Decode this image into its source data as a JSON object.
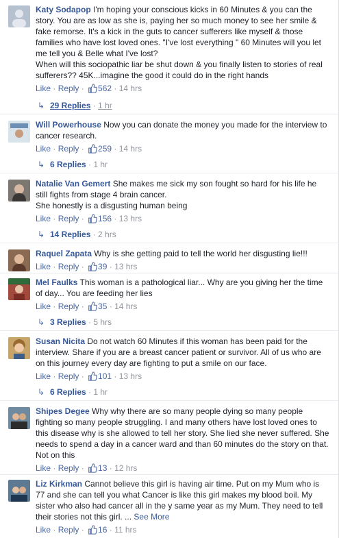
{
  "ui": {
    "like": "Like",
    "reply": "Reply",
    "sep": " · "
  },
  "comments": [
    {
      "author": "Katy Sodapop",
      "text": "I'm hoping your conscious kicks in 60 Minutes & you can the story. You are as low as she is, paying her so much money to see her smile & fake remorse. It's a kick in the guts to cancer sufferers like myself & those families who have lost loved ones. \"I've lost everything \" 60 Minutes will you let me tell you & Belle what I've lost?\nWhen will this sociopathic liar be shut down & you finally listen to stories of real sufferers?? 45K...imagine the good it could do in the right hands",
      "likes": "562",
      "time": "14 hrs",
      "replies": "29 Replies",
      "reply_time": "1 hr"
    },
    {
      "author": "Will Powerhouse",
      "text": "Now you can donate the money you made for the interview to cancer research.",
      "likes": "259",
      "time": "14 hrs",
      "replies": "6 Replies",
      "reply_time": "1 hr"
    },
    {
      "author": "Natalie Van Gemert",
      "text": "She makes me sick my son fought so hard for his life he still fights from stage 4 brain cancer.\nShe honestly is a disgusting human being",
      "likes": "156",
      "time": "13 hrs",
      "replies": "14 Replies",
      "reply_time": "2 hrs"
    },
    {
      "author": "Raquel Zapata",
      "text": "Why is she getting paid to tell the world her disgusting lie!!!",
      "likes": "39",
      "time": "13 hrs"
    },
    {
      "author": "Mel Faulks",
      "text": "This woman is a pathological liar... Why are you giving her the time of day... You are feeding her lies",
      "likes": "35",
      "time": "14 hrs",
      "replies": "3 Replies",
      "reply_time": "5 hrs"
    },
    {
      "author": "Susan Nicita",
      "text": "Do not watch 60 Minutes if this woman has been paid for the interview. Share if you are a breast cancer patient or survivor. All of us who are on this journey every day are fighting to put a smile on our face.",
      "likes": "101",
      "time": "13 hrs",
      "replies": "6 Replies",
      "reply_time": "1 hr"
    },
    {
      "author": "Shipes Degee",
      "text": "Why why there are so many people dying so many people fighting so many people struggling. I and many others have lost loved ones to this disease why is she allowed to tell her story. She lied she never suffered. She needs to spend a day in a cancer ward and than 60 minutes do the story on that. Not on this",
      "likes": "13",
      "time": "12 hrs"
    },
    {
      "author": "Liz Kirkman",
      "text": "Cannot believe this girl is having air time. Put on my Mum who is 77 and she can tell you what Cancer is like this girl makes my blood boil. My sister who also had cancer all in the y same year as my Mum. They need to tell their stories not this girl. ...",
      "see_more": "See More",
      "likes": "16",
      "time": "11 hrs"
    }
  ]
}
